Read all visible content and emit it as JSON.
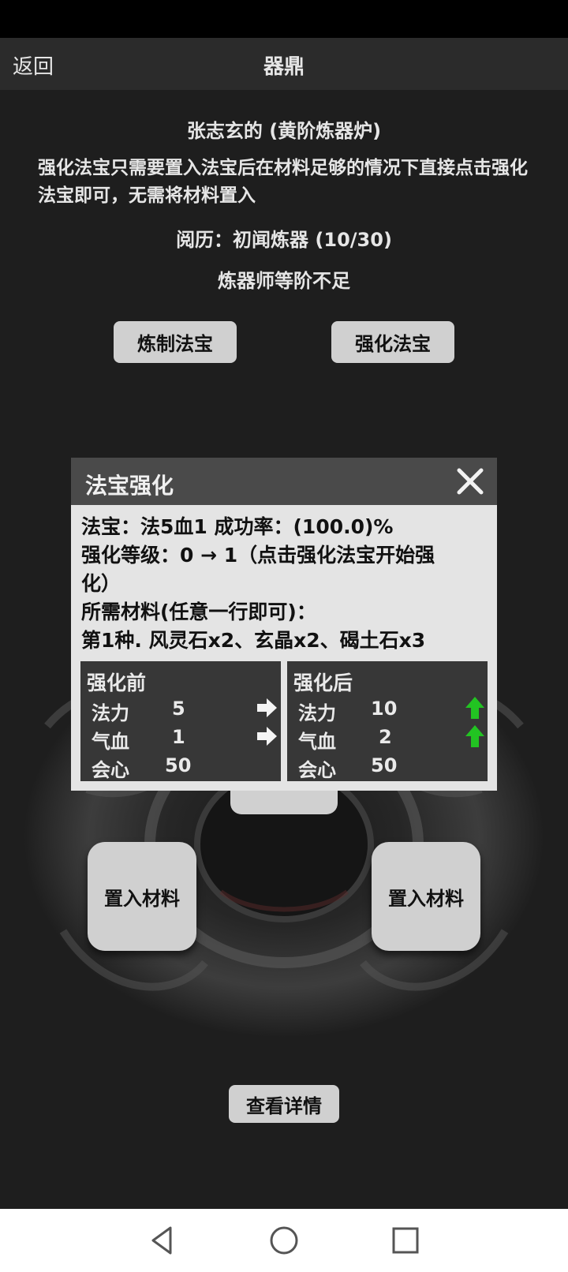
{
  "header": {
    "back_label": "返回",
    "title": "器鼎"
  },
  "info": {
    "furnace_owner": "张志玄的 (黄阶炼器炉)",
    "hint": "强化法宝只需要置入法宝后在材料足够的情况下直接点击强化法宝即可，无需将材料置入",
    "experience": "阅历：初闻炼器 (10/30)",
    "rank_warning": "炼器师等阶不足"
  },
  "actions": {
    "refine_label": "炼制法宝",
    "enhance_label": "强化法宝",
    "place_material_left": "置入材料",
    "place_material_right": "置入材料",
    "view_details": "查看详情"
  },
  "modal": {
    "title": "法宝强化",
    "treasure_line": "法宝：法5血1 成功率：(100.0)%",
    "level_line_1": "强化等级：0 → 1（点击强化法宝开始强",
    "level_line_2": "化）",
    "materials_heading": "所需材料(任意一行即可)：",
    "materials_option": "第1种. 风灵石x2、玄晶x2、碣土石x3",
    "before": {
      "title": "强化前",
      "stats": [
        {
          "name": "法力",
          "value": "5"
        },
        {
          "name": "气血",
          "value": "1"
        },
        {
          "name": "会心",
          "value": "50"
        }
      ]
    },
    "after": {
      "title": "强化后",
      "stats": [
        {
          "name": "法力",
          "value": "10"
        },
        {
          "name": "气血",
          "value": "2"
        },
        {
          "name": "会心",
          "value": "50"
        }
      ]
    }
  },
  "colors": {
    "background": "#1e1e1e",
    "title_bar": "#2b2b2b",
    "modal_header": "#4a4a4a",
    "modal_body": "#e4e4e4",
    "panel": "#373737",
    "button": "#d0d0d0",
    "up_arrow": "#22c322"
  },
  "icons": {
    "close": "close-icon",
    "right_arrow": "arrow-right-icon",
    "up_arrow": "arrow-up-green-icon",
    "nav_back": "triangle-back-icon",
    "nav_home": "circle-home-icon",
    "nav_recent": "square-recent-icon"
  }
}
